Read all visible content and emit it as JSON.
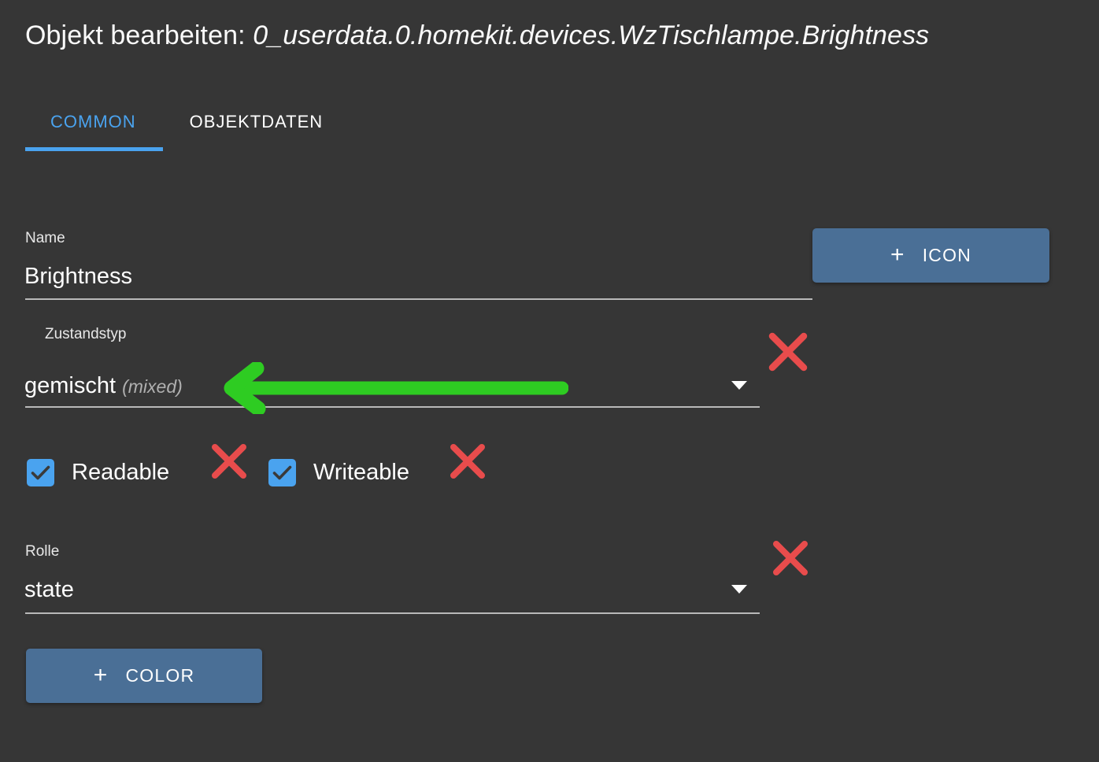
{
  "dialog": {
    "title_prefix": "Objekt bearbeiten: ",
    "title_path": "0_userdata.0.homekit.devices.WzTischlampe.Brightness"
  },
  "tabs": [
    {
      "label": "COMMON",
      "active": true
    },
    {
      "label": "OBJEKTDATEN",
      "active": false
    }
  ],
  "fields": {
    "name": {
      "label": "Name",
      "value": "Brightness"
    },
    "state_type": {
      "label": "Zustandstyp",
      "value": "gemischt",
      "value_suffix": "(mixed)"
    },
    "role": {
      "label": "Rolle",
      "value": "state"
    }
  },
  "checkboxes": [
    {
      "label": "Readable",
      "checked": true
    },
    {
      "label": "Writeable",
      "checked": true
    }
  ],
  "buttons": {
    "icon": {
      "plus": "+",
      "label": "ICON"
    },
    "color": {
      "plus": "+",
      "label": "COLOR"
    }
  },
  "annotations": {
    "red_x_color": "#e84c4c",
    "green_arrow_color": "#2ecc22",
    "red_x_marks": [
      {
        "target": "state-type-field"
      },
      {
        "target": "readable-checkbox"
      },
      {
        "target": "writeable-checkbox"
      },
      {
        "target": "role-field"
      }
    ],
    "green_arrow": {
      "points_to": "state-type-value",
      "direction": "left"
    }
  },
  "colors": {
    "background": "#363636",
    "accent_blue": "#4aa3ef",
    "button_blue": "#4a6f96",
    "underline": "#b9b9b9"
  }
}
